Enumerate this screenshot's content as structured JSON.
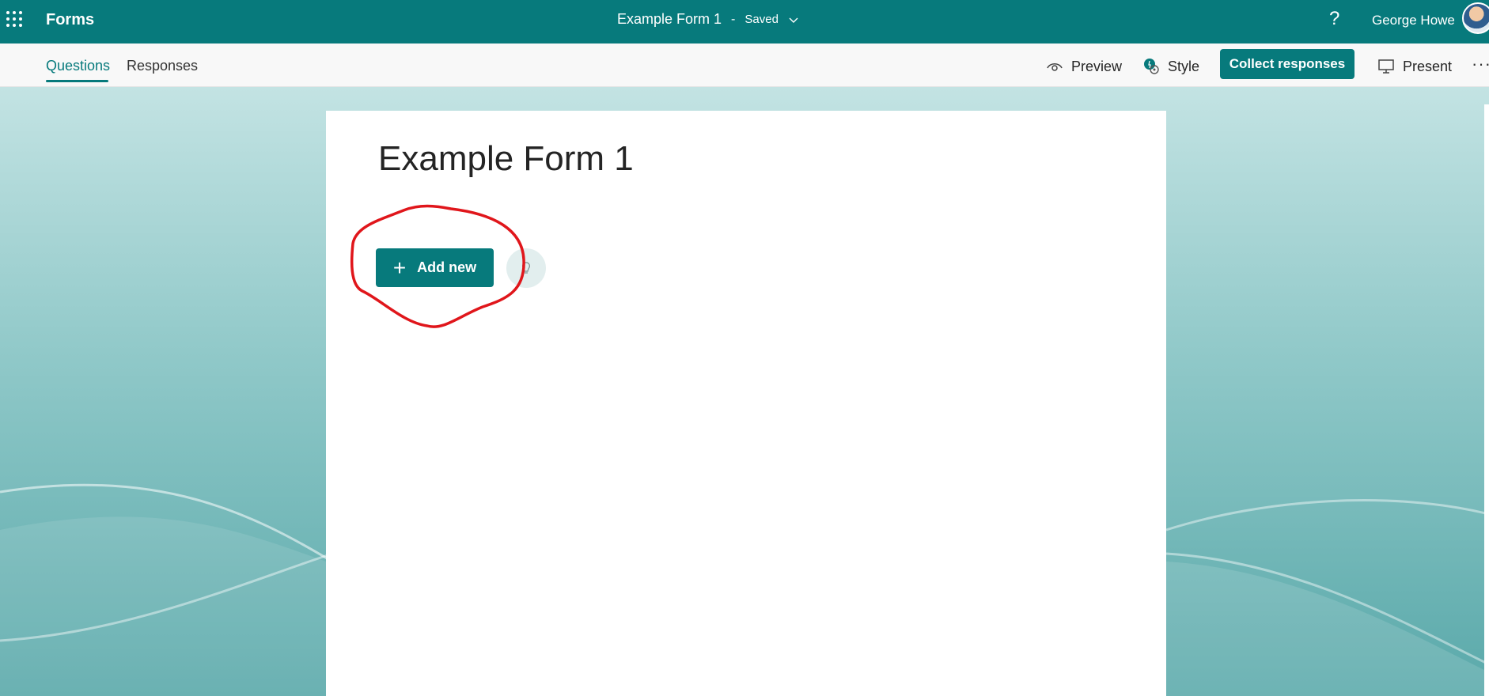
{
  "appbar": {
    "app_name": "Forms",
    "doc_title": "Example Form 1",
    "separator": "-",
    "save_status": "Saved",
    "help_label": "?",
    "user_name": "George Howe"
  },
  "tabs": [
    {
      "label": "Questions",
      "active": true
    },
    {
      "label": "Responses",
      "active": false
    }
  ],
  "commands": {
    "preview": "Preview",
    "style": "Style",
    "collect": "Collect responses",
    "present": "Present",
    "more": "···"
  },
  "form": {
    "title": "Example Form 1",
    "add_new_label": "Add new"
  },
  "colors": {
    "brand": "#077a7c",
    "annotation": "#e0161b"
  },
  "icons": [
    "app-launcher-icon",
    "chevron-down-icon",
    "eye-icon",
    "palette-icon",
    "monitor-icon",
    "plus-icon",
    "lightbulb-icon"
  ]
}
